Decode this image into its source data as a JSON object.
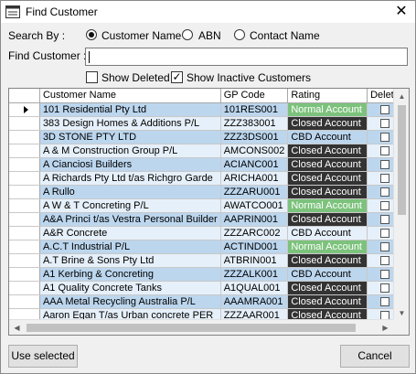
{
  "window": {
    "title": "Find Customer",
    "close_glyph": "✕"
  },
  "search_by": {
    "label": "Search By :",
    "options": [
      {
        "label": "Customer Name",
        "selected": true
      },
      {
        "label": "ABN",
        "selected": false
      },
      {
        "label": "Contact Name",
        "selected": false
      }
    ]
  },
  "find_customer": {
    "label": "Find Customer :",
    "value": ""
  },
  "filters": {
    "show_deleted": {
      "label": "Show Deleted",
      "checked": false
    },
    "show_inactive": {
      "label": "Show Inactive Customers",
      "checked": true
    }
  },
  "grid": {
    "columns": [
      "Customer Name",
      "GP Code",
      "Rating",
      "Deleted"
    ],
    "rows": [
      {
        "name": "101 Residential Pty Ltd",
        "code": "101RES001",
        "rating": "Normal Account",
        "current": true
      },
      {
        "name": "383 Design Homes & Additions P/L",
        "code": "ZZZ383001",
        "rating": "Closed Account"
      },
      {
        "name": "3D STONE PTY LTD",
        "code": "ZZZ3DS001",
        "rating": "CBD Account"
      },
      {
        "name": "A & M Construction Group P/L",
        "code": "AMCONS002",
        "rating": "Closed Account"
      },
      {
        "name": "A Cianciosi Builders",
        "code": "ACIANC001",
        "rating": "Closed Account"
      },
      {
        "name": "A Richards Pty Ltd t/as Richgro Garde",
        "code": "ARICHA001",
        "rating": "Closed Account"
      },
      {
        "name": "A Rullo",
        "code": "ZZZARU001",
        "rating": "Closed Account"
      },
      {
        "name": "A W & T Concreting P/L",
        "code": "AWATCO001",
        "rating": "Normal Account"
      },
      {
        "name": "A&A Princi t/as Vestra Personal Builder",
        "code": "AAPRIN001",
        "rating": "Closed Account"
      },
      {
        "name": "A&R Concrete",
        "code": "ZZZARC002",
        "rating": "CBD Account"
      },
      {
        "name": "A.C.T Industrial P/L",
        "code": "ACTIND001",
        "rating": "Normal Account"
      },
      {
        "name": "A.T  Brine & Sons Pty Ltd",
        "code": "ATBRIN001",
        "rating": "Closed Account"
      },
      {
        "name": "A1 Kerbing & Concreting",
        "code": "ZZZALK001",
        "rating": "CBD Account"
      },
      {
        "name": "A1 Quality Concrete Tanks",
        "code": "A1QUAL001",
        "rating": "Closed Account"
      },
      {
        "name": "AAA Metal Recycling Australia P/L",
        "code": "AAAMRA001",
        "rating": "Closed Account"
      },
      {
        "name": "Aaron Egan T/as Urban concrete PER",
        "code": "ZZZAAR001",
        "rating": "Closed Account"
      }
    ]
  },
  "buttons": {
    "use_selected": "Use selected",
    "cancel": "Cancel"
  },
  "colors": {
    "normal": "#7cc27c",
    "closed": "#333333",
    "row_blue": "#bcd6ee",
    "row_white": "#e6f0fa"
  }
}
